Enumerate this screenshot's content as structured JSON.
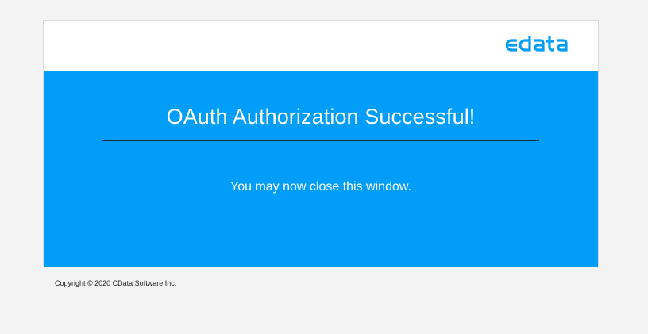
{
  "brand": {
    "logo_text": "cdata",
    "logo_color": "#009ef9"
  },
  "main": {
    "title": "OAuth Authorization Successful!",
    "message": "You may now close this window.",
    "panel_color": "#009ef9"
  },
  "footer": {
    "copyright": "Copyright © 2020 CData Software Inc."
  }
}
